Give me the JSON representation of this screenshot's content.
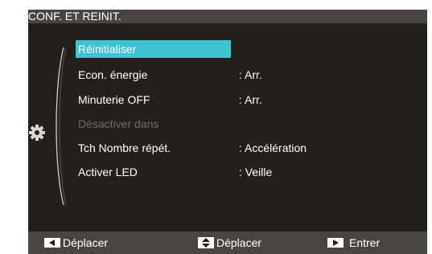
{
  "menu": {
    "title": "CONF. ET REINIT.",
    "items": [
      {
        "label": "Réinitialiser",
        "value": "",
        "state": "selected"
      },
      {
        "label": "Econ. énergie",
        "value": ":  Arr.",
        "state": "normal"
      },
      {
        "label": "Minuterie OFF",
        "value": ":  Arr.",
        "state": "normal"
      },
      {
        "label": "Désactiver dans",
        "value": "",
        "state": "disabled"
      },
      {
        "label": "Tch Nombre répét.",
        "value": ":  Accélération",
        "state": "normal"
      },
      {
        "label": "Activer LED",
        "value": ":  Veille",
        "state": "normal"
      }
    ]
  },
  "footer": {
    "hints": [
      {
        "icon": "left-arrow-key-icon",
        "label": "Déplacer"
      },
      {
        "icon": "up-down-arrow-key-icon",
        "label": "Déplacer"
      },
      {
        "icon": "right-arrow-key-icon",
        "label": "Entrer"
      }
    ]
  },
  "colors": {
    "background": "#231f1a",
    "bar": "#4a4540",
    "highlight": "#3cc4d2",
    "disabled_text": "#6f6a64",
    "text": "#ffffff"
  },
  "icons": {
    "category": "gear-icon"
  }
}
